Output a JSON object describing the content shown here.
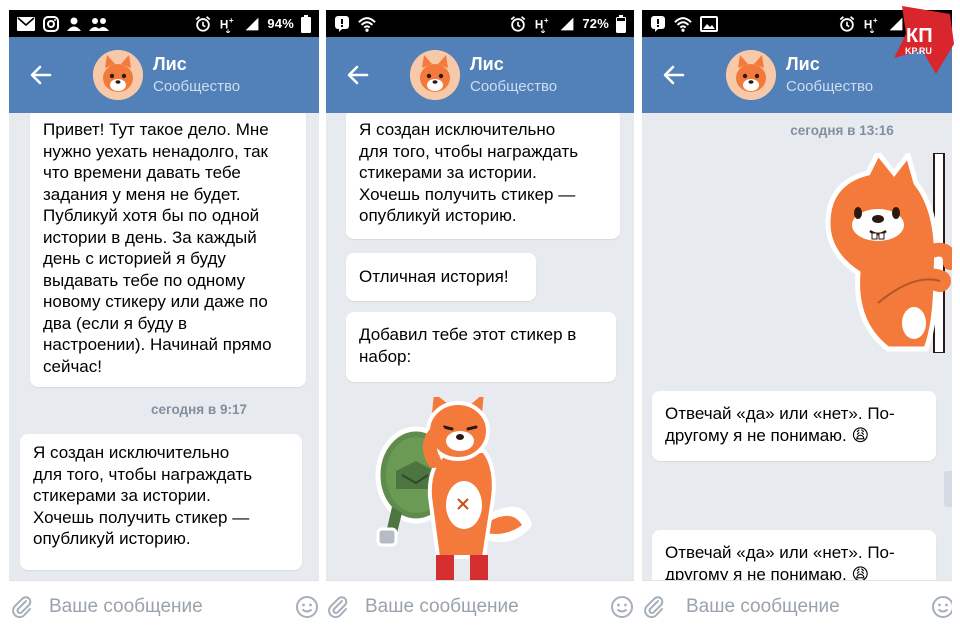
{
  "status_bars": [
    {
      "battery": "94%"
    },
    {
      "battery": "72%"
    },
    {
      "battery": ""
    }
  ],
  "header": {
    "name": "Лис",
    "subtitle": "Сообщество"
  },
  "panel1": {
    "msg1": "Привет! Тут такое дело. Мне\nнужно уехать ненадолго, так\nчто времени давать тебе\nзадания у меня не будет.\nПубликуй хотя бы по одной\nистории в день. За каждый\nдень с историей я буду\nвыдавать тебе по одному\nновому стикеру или даже по\nдва (если я буду в\nнастроении). Начинай прямо\nсейчас!",
    "timestamp": "сегодня в 9:17",
    "msg2": "Я создан исключительно\nдля того, чтобы награждать\nстикерами за истории.\nХочешь получить стикер —\nопубликуй историю."
  },
  "panel2": {
    "msg1": "Я создан исключительно\nдля того, чтобы награждать\nстикерами за истории.\nХочешь получить стикер —\nопубликуй историю.",
    "msg2": "Отличная история!",
    "msg3": "Добавил тебе этот стикер в\nнабор:"
  },
  "panel3": {
    "timestamp": "сегодня в 13:16",
    "msg1": "Отвечай «да» или «нет». По-\nдругому я не понимаю. 😩",
    "msg2": "Отвечай «да» или «нет». По-\nдругому я не понимаю. 😩"
  },
  "composer": {
    "placeholder": "Ваше сообщение"
  },
  "logo": {
    "line1": "КП",
    "line2": "KP.RU"
  },
  "colors": {
    "header": "#5181b8",
    "chat_bg": "#e7ebf0",
    "fox": "#f47a3c",
    "logo_red": "#d8262c"
  },
  "icons": [
    "mail-icon",
    "instagram-icon",
    "person-icon",
    "group-icon",
    "alarm-icon",
    "signal-icon",
    "battery-icon",
    "wifi-icon",
    "image-icon",
    "back-arrow-icon",
    "paperclip-icon",
    "smiley-icon"
  ]
}
